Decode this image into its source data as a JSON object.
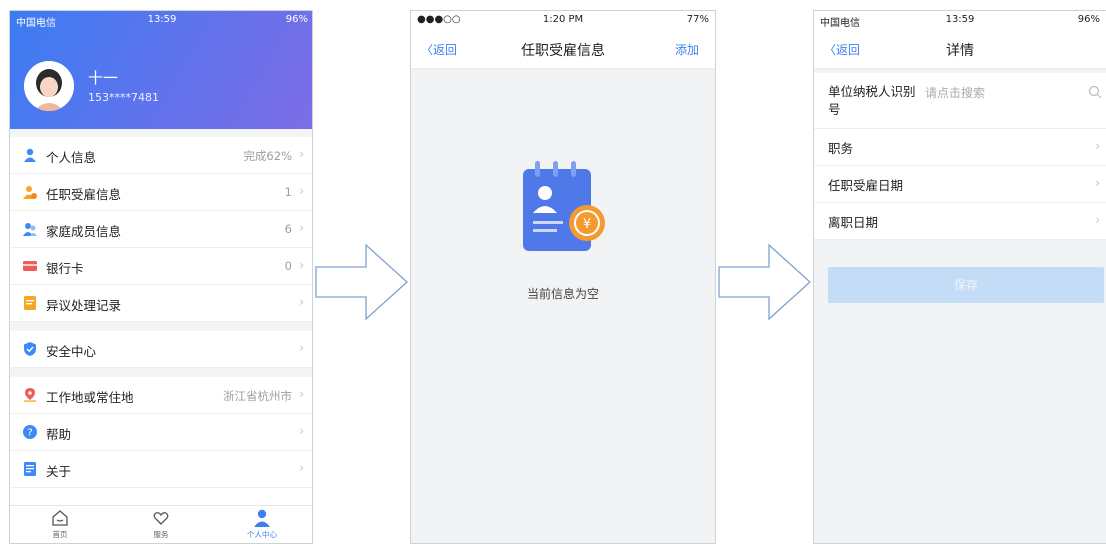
{
  "screen1": {
    "status": {
      "carrier": "中国电信",
      "time": "13:59",
      "battery": "96%"
    },
    "profile": {
      "name": "十一",
      "phone": "153****7481"
    },
    "menu_group1": [
      {
        "label": "个人信息",
        "value": "完成62%",
        "icon": "person-icon",
        "color": "#3d8af7"
      },
      {
        "label": "任职受雇信息",
        "value": "1",
        "icon": "employment-icon",
        "color": "#f5a623"
      },
      {
        "label": "家庭成员信息",
        "value": "6",
        "icon": "family-icon",
        "color": "#3d8af7"
      },
      {
        "label": "银行卡",
        "value": "0",
        "icon": "bank-card-icon",
        "color": "#f25a5a"
      },
      {
        "label": "异议处理记录",
        "value": "",
        "icon": "record-icon",
        "color": "#f5a623"
      }
    ],
    "menu_group2": [
      {
        "label": "安全中心",
        "value": "",
        "icon": "shield-icon",
        "color": "#3d8af7"
      }
    ],
    "menu_group3": [
      {
        "label": "工作地或常住地",
        "value": "浙江省杭州市",
        "icon": "location-icon",
        "color": "#f25a5a"
      },
      {
        "label": "帮助",
        "value": "",
        "icon": "help-icon",
        "color": "#3d8af7"
      },
      {
        "label": "关于",
        "value": "",
        "icon": "about-icon",
        "color": "#3d8af7"
      }
    ],
    "tabs": [
      {
        "label": "首页",
        "icon": "home-icon"
      },
      {
        "label": "服务",
        "icon": "service-icon"
      },
      {
        "label": "个人中心",
        "icon": "user-center-icon"
      }
    ]
  },
  "screen2": {
    "status": {
      "signal": "●●●○○",
      "time": "1:20 PM",
      "battery": "77%"
    },
    "back": "返回",
    "title": "任职受雇信息",
    "action": "添加",
    "empty_text": "当前信息为空"
  },
  "screen3": {
    "status": {
      "carrier": "中国电信",
      "time": "13:59",
      "battery": "96%"
    },
    "back": "返回",
    "title": "详情",
    "fields": [
      {
        "label": "单位纳税人识别号",
        "placeholder": "请点击搜索"
      },
      {
        "label": "职务"
      },
      {
        "label": "任职受雇日期"
      },
      {
        "label": "离职日期"
      }
    ],
    "save": "保存"
  },
  "colors": {
    "accent": "#3d7ff0",
    "save_disabled": "#c5dcf7",
    "arrow": "#7fa3cf"
  }
}
